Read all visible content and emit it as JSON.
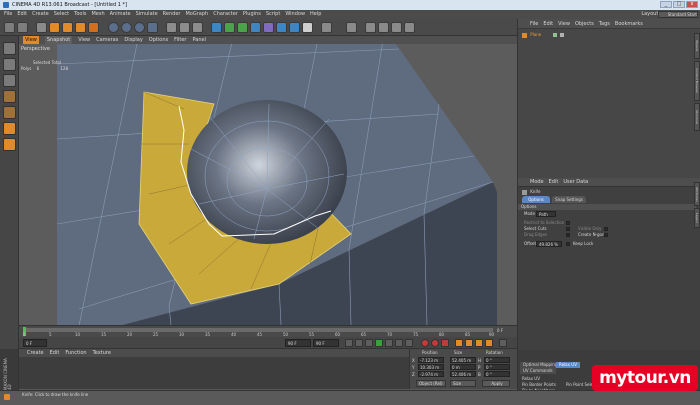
{
  "window": {
    "title": "CINEMA 4D R13.061 Broadcast - [Untitled 1 *]",
    "controls": [
      "_",
      "□",
      "x"
    ]
  },
  "menu": [
    "File",
    "Edit",
    "Create",
    "Select",
    "Tools",
    "Mesh",
    "Animate",
    "Simulate",
    "Render",
    "MoGraph",
    "Character",
    "Plugins",
    "Script",
    "Window",
    "Help"
  ],
  "layout": {
    "label": "Layout:",
    "value": "Standard Start"
  },
  "viewport": {
    "tabs": [
      "View",
      "Snapshot"
    ],
    "menu": [
      "View",
      "Cameras",
      "Display",
      "Options",
      "Filter",
      "Panel"
    ],
    "camera": "Perspective",
    "selection": {
      "header": "Selected Total",
      "polys_label": "Polys",
      "polys_selected": "6",
      "polys_total": "128"
    }
  },
  "timeline": {
    "ticks": [
      "0",
      "5",
      "10",
      "15",
      "20",
      "25",
      "30",
      "35",
      "40",
      "45",
      "50",
      "55",
      "60",
      "65",
      "70",
      "75",
      "80",
      "85",
      "90"
    ],
    "end_frame": "0 F"
  },
  "transport": {
    "start": "0 F",
    "end": "90 F",
    "current": "90 F"
  },
  "materials": {
    "menu": [
      "Create",
      "Edit",
      "Function",
      "Texture"
    ]
  },
  "coordinates": {
    "headers": [
      "Position",
      "Size",
      "Rotation"
    ],
    "rows": [
      {
        "axis": "X",
        "pos": "-7.123 m",
        "size": "52.405 m",
        "rot_axis": "H",
        "rot": "0 °"
      },
      {
        "axis": "Y",
        "pos": "10.303 m",
        "size": "0 m",
        "rot_axis": "P",
        "rot": "0 °"
      },
      {
        "axis": "Z",
        "pos": "-2.974 m",
        "size": "52.406 m",
        "rot_axis": "B",
        "rot": "0 °"
      }
    ],
    "mode": "Object (Rel)",
    "size_mode": "Size",
    "apply": "Apply"
  },
  "objects": {
    "menu": [
      "File",
      "Edit",
      "View",
      "Objects",
      "Tags",
      "Bookmarks"
    ],
    "items": [
      {
        "name": "Plane"
      }
    ],
    "side_tabs": [
      "Objects",
      "Content Browser",
      "Structure"
    ]
  },
  "attributes": {
    "menu": [
      "Mode",
      "Edit",
      "User Data"
    ],
    "tool_name": "Knife",
    "tabs": [
      "Options",
      "Snap Settings"
    ],
    "section": "Options",
    "mode_label": "Mode",
    "mode_value": "Path",
    "fields": [
      {
        "label": "Restrict to Selection",
        "checked": false
      },
      {
        "label": "Select Cuts",
        "checked": true,
        "right_label": "Visible Only",
        "right_checked": false
      },
      {
        "label": "Drag Edges",
        "checked": false,
        "right_label": "Create N-gons",
        "right_checked": true
      }
    ],
    "offset_label": "Offset",
    "offset_value": "49.826 %",
    "keep_label": "Keep Lock",
    "side_tabs": [
      "Attributes",
      "Layers"
    ]
  },
  "uv": {
    "tabs": [
      "Optimal Mapping",
      "Relax UV"
    ],
    "sub_tab": "UV Commands",
    "title": "Relax UV",
    "rows": [
      "Pin Border Points",
      "Pin to Neighbors"
    ],
    "right_row": "Pin Point Selection"
  },
  "status": {
    "text": "Knife: Click to draw the knife line"
  },
  "brand": {
    "maxon": "MAXON CINEMA 4D",
    "watermark": "mytour.vn"
  },
  "colors": {
    "selection": "#c9a93a",
    "accent": "#f7a030",
    "watermark": "#e60023"
  }
}
